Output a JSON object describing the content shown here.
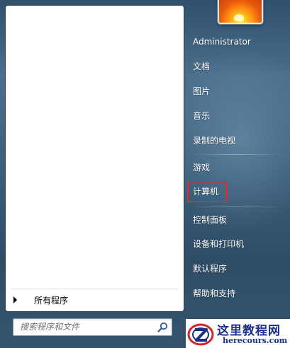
{
  "left_pane": {
    "all_programs": "所有程序",
    "search_placeholder": "搜索程序和文件"
  },
  "user": {
    "picture_icon": "flower-user-picture"
  },
  "right_pane": {
    "items": [
      {
        "label": "Administrator"
      },
      {
        "label": "文档"
      },
      {
        "label": "图片"
      },
      {
        "label": "音乐"
      },
      {
        "label": "录制的电视"
      },
      {
        "label": "游戏"
      },
      {
        "label": "计算机"
      },
      {
        "label": "控制面板"
      },
      {
        "label": "设备和打印机"
      },
      {
        "label": "默认程序"
      },
      {
        "label": "帮助和支持"
      }
    ],
    "highlighted_item": "计算机",
    "highlight_color": "#e8262f"
  },
  "watermark": {
    "title": "这里教程网",
    "url": "herecours.com"
  },
  "colors": {
    "glass_top": "#30506c",
    "glass_mid": "#4a6f8d",
    "pane_bg": "#ffffff",
    "text_light": "#ffffff"
  }
}
